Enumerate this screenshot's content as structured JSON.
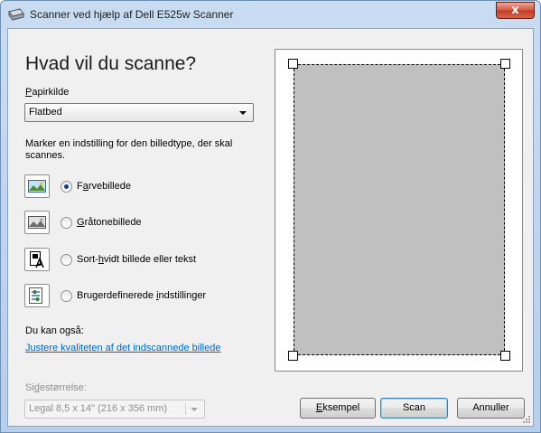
{
  "window": {
    "title": "Scanner ved hjælp af Dell E525w Scanner",
    "close_glyph": "x"
  },
  "main": {
    "heading": "Hvad vil du scanne?",
    "paper_source_label_u": "P",
    "paper_source_label_rest": "apirkilde",
    "paper_source_value": "Flatbed",
    "picture_type_desc": "Marker en indstilling for den billedtype, der skal scannes.",
    "options": [
      {
        "pre": "F",
        "u": "a",
        "post": "rvebillede",
        "icon": "color-picture-icon",
        "selected": true
      },
      {
        "pre": "",
        "u": "G",
        "post": "råtonebillede",
        "icon": "grayscale-picture-icon",
        "selected": false
      },
      {
        "pre": "Sort-",
        "u": "h",
        "post": "vidt billede eller tekst",
        "icon": "black-white-text-icon",
        "selected": false
      },
      {
        "pre": "Brugerdefinerede ",
        "u": "i",
        "post": "ndstillinger",
        "icon": "custom-settings-icon",
        "selected": false
      }
    ],
    "also_label": "Du kan også:",
    "adjust_link": "Justere kvaliteten af det indscannede billede",
    "page_size_label_pre": "Si",
    "page_size_label_u": "d",
    "page_size_label_post": "estørrelse:",
    "page_size_value": "Legal 8,5 x 14\" (216 x 356 mm)"
  },
  "buttons": {
    "preview_u": "E",
    "preview_rest": "ksempel",
    "scan": "Scan",
    "cancel": "Annuller"
  },
  "colors": {
    "link": "#0066cc",
    "preview_page": "#c0c0c0",
    "close_button": "#c13a1f"
  }
}
